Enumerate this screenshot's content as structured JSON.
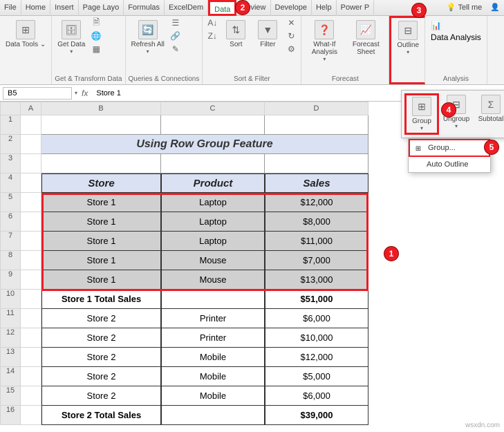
{
  "ribbon": {
    "tabs": [
      "File",
      "Home",
      "Insert",
      "Page Layo",
      "Formulas",
      "ExcelDem",
      "Data",
      "Review",
      "Develope",
      "Help",
      "Power P"
    ],
    "tellme": "Tell me",
    "activeTab": "Data",
    "groups": {
      "dataTools": {
        "label": "Data Tools ⌄",
        "btn": "Data Tools"
      },
      "getTransform": {
        "label": "Get & Transform Data",
        "getData": "Get Data"
      },
      "queries": {
        "label": "Queries & Connections",
        "refresh": "Refresh All"
      },
      "sortFilter": {
        "label": "Sort & Filter",
        "sort": "Sort",
        "filter": "Filter"
      },
      "forecast": {
        "label": "Forecast",
        "whatif": "What-If Analysis",
        "forecast": "Forecast Sheet"
      },
      "outline": {
        "label": "Outline",
        "btn": "Outline"
      },
      "analysis": {
        "label": "Analysis",
        "btn": "Data Analysis"
      }
    }
  },
  "flyout": {
    "group": "Group",
    "ungroup": "Ungroup",
    "subtotal": "Subtotal",
    "groupMenu": "Group...",
    "autoOutline": "Auto Outline"
  },
  "namebox": "B5",
  "formula": "Store 1",
  "columns": [
    "A",
    "B",
    "C",
    "D"
  ],
  "title": "Using Row Group Feature",
  "headers": {
    "store": "Store",
    "product": "Product",
    "sales": "Sales"
  },
  "rows": [
    {
      "n": 5,
      "b": "Store 1",
      "c": "Laptop",
      "d": "$12,000",
      "sel": true
    },
    {
      "n": 6,
      "b": "Store 1",
      "c": "Laptop",
      "d": "$8,000",
      "sel": true
    },
    {
      "n": 7,
      "b": "Store 1",
      "c": "Laptop",
      "d": "$11,000",
      "sel": true
    },
    {
      "n": 8,
      "b": "Store 1",
      "c": "Mouse",
      "d": "$7,000",
      "sel": true
    },
    {
      "n": 9,
      "b": "Store 1",
      "c": "Mouse",
      "d": "$13,000",
      "sel": true
    },
    {
      "n": 10,
      "b": "Store 1 Total Sales",
      "c": "",
      "d": "$51,000",
      "bold": true
    },
    {
      "n": 11,
      "b": "Store 2",
      "c": "Printer",
      "d": "$6,000"
    },
    {
      "n": 12,
      "b": "Store 2",
      "c": "Printer",
      "d": "$10,000"
    },
    {
      "n": 13,
      "b": "Store 2",
      "c": "Mobile",
      "d": "$12,000"
    },
    {
      "n": 14,
      "b": "Store 2",
      "c": "Mobile",
      "d": "$5,000"
    },
    {
      "n": 15,
      "b": "Store 2",
      "c": "Mobile",
      "d": "$6,000"
    },
    {
      "n": 16,
      "b": "Store 2 Total Sales",
      "c": "",
      "d": "$39,000",
      "bold": true
    }
  ],
  "callouts": {
    "c1": "1",
    "c2": "2",
    "c3": "3",
    "c4": "4",
    "c5": "5"
  },
  "watermark": "wsxdn.com"
}
